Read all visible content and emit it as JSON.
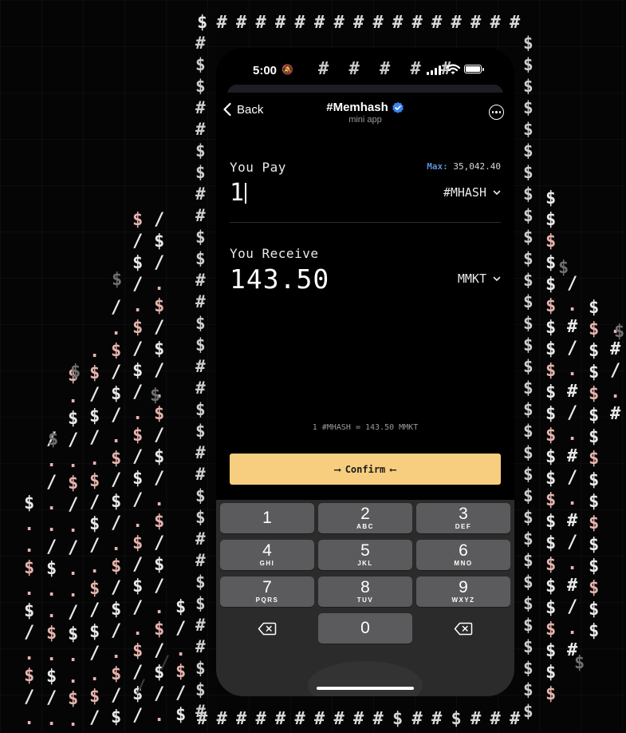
{
  "status_bar": {
    "time": "5:00",
    "hashes": "# # # # #",
    "silent_icon": "bell-slash-icon",
    "signal_icon": "cellular-signal-icon",
    "wifi_icon": "wifi-icon",
    "battery_icon": "battery-full-icon"
  },
  "header": {
    "back_label": "Back",
    "title": "#Memhash",
    "subtitle": "mini app",
    "verified_icon": "verified-badge-icon",
    "more_icon": "more-options-icon"
  },
  "swap": {
    "pay_label": "You Pay",
    "max_label": "Max:",
    "max_value": "35,042.40",
    "pay_amount": "1",
    "pay_token": "#MHASH",
    "receive_label": "You Receive",
    "receive_amount": "143.50",
    "receive_token": "MMKT",
    "rate": "1 #MHASH = 143.50 MMKT",
    "confirm_label": "Confirm",
    "confirm_left_arrow": "⟶",
    "confirm_right_arrow": "⟵"
  },
  "keyboard": {
    "keys": [
      {
        "num": "1",
        "letters": ""
      },
      {
        "num": "2",
        "letters": "ABC"
      },
      {
        "num": "3",
        "letters": "DEF"
      },
      {
        "num": "4",
        "letters": "GHI"
      },
      {
        "num": "5",
        "letters": "JKL"
      },
      {
        "num": "6",
        "letters": "MNO"
      },
      {
        "num": "7",
        "letters": "PQRS"
      },
      {
        "num": "8",
        "letters": "TUV"
      },
      {
        "num": "9",
        "letters": "WXYZ"
      },
      {
        "num": "0",
        "letters": ""
      }
    ],
    "delete_icon": "backspace-icon"
  },
  "colors": {
    "accent_button": "#f7cd7f",
    "max_label": "#5d8fd6",
    "verified_badge": "#3a86f0",
    "art_white": "#e9e9e9",
    "art_pink": "#e8b4ae"
  }
}
